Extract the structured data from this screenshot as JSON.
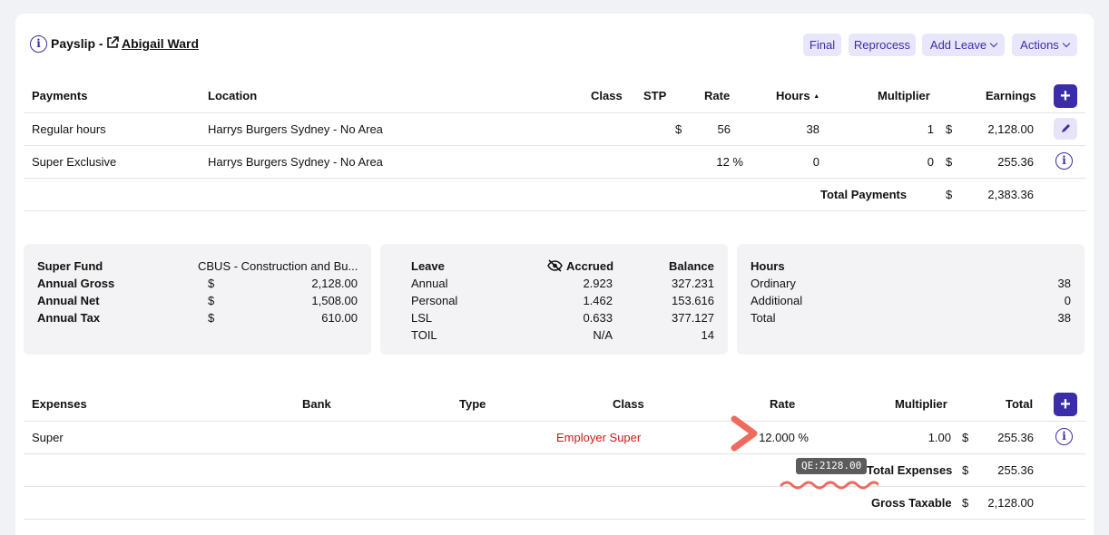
{
  "header": {
    "title": "Payslip - ",
    "employee_name": "Abigail Ward",
    "buttons": {
      "final": "Final",
      "reprocess": "Reprocess",
      "add_leave": "Add Leave",
      "actions": "Actions"
    }
  },
  "payments": {
    "headers": {
      "payments": "Payments",
      "location": "Location",
      "class": "Class",
      "stp": "STP",
      "rate": "Rate",
      "hours": "Hours",
      "sort": "▲",
      "multiplier": "Multiplier",
      "earnings": "Earnings"
    },
    "rows": [
      {
        "name": "Regular hours",
        "location": "Harrys Burgers Sydney - No Area",
        "rate_prefix": "$",
        "rate": "56",
        "hours": "38",
        "multiplier": "1",
        "currency": "$",
        "earnings": "2,128.00"
      },
      {
        "name": "Super Exclusive",
        "location": "Harrys Burgers Sydney - No Area",
        "rate_prefix": "",
        "rate": "12 %",
        "hours": "0",
        "multiplier": "0",
        "currency": "$",
        "earnings": "255.36"
      }
    ],
    "total_label": "Total Payments",
    "total_currency": "$",
    "total": "2,383.36"
  },
  "super_panel": {
    "fund_label": "Super Fund",
    "fund_value": "CBUS - Construction and Bu...",
    "rows": [
      {
        "label": "Annual Gross",
        "currency": "$",
        "value": "2,128.00"
      },
      {
        "label": "Annual Net",
        "currency": "$",
        "value": "1,508.00"
      },
      {
        "label": "Annual Tax",
        "currency": "$",
        "value": "610.00"
      }
    ]
  },
  "leave_panel": {
    "headers": {
      "leave": "Leave",
      "accrued": "Accrued",
      "balance": "Balance"
    },
    "rows": [
      {
        "type": "Annual",
        "accrued": "2.923",
        "balance": "327.231"
      },
      {
        "type": "Personal",
        "accrued": "1.462",
        "balance": "153.616"
      },
      {
        "type": "LSL",
        "accrued": "0.633",
        "balance": "377.127"
      },
      {
        "type": "TOIL",
        "accrued": "N/A",
        "balance": "14"
      }
    ]
  },
  "hours_panel": {
    "title": "Hours",
    "rows": [
      {
        "label": "Ordinary",
        "value": "38"
      },
      {
        "label": "Additional",
        "value": "0"
      },
      {
        "label": "Total",
        "value": "38"
      }
    ]
  },
  "expenses": {
    "headers": {
      "expenses": "Expenses",
      "bank": "Bank",
      "type": "Type",
      "class": "Class",
      "rate": "Rate",
      "multiplier": "Multiplier",
      "total": "Total"
    },
    "row": {
      "name": "Super",
      "class": "Employer Super",
      "rate": "12.000 %",
      "multiplier": "1.00",
      "currency": "$",
      "total": "255.36"
    },
    "total_expenses_label": "Total Expenses",
    "total_expenses_currency": "$",
    "total_expenses": "255.36",
    "gross_taxable_label": "Gross Taxable",
    "gross_taxable_currency": "$",
    "gross_taxable": "2,128.00"
  },
  "tooltip": "QE:2128.00",
  "colors": {
    "accent": "#3b2ca8",
    "annotation": "#f06a5e",
    "employer_super": "#c91a1a"
  }
}
